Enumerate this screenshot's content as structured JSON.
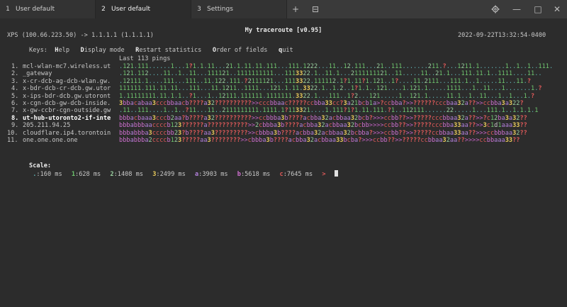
{
  "tabs": [
    {
      "num": "1",
      "label": "User default",
      "active": false
    },
    {
      "num": "2",
      "label": "User default",
      "active": true
    },
    {
      "num": "3",
      "label": "Settings",
      "active": false
    }
  ],
  "toolbar": {
    "new_tab": "+",
    "split": "⊟"
  },
  "window_controls": {
    "settings_icon": "gear-icon",
    "minimize": "—",
    "maximize": "□",
    "close": "✕"
  },
  "header": {
    "title": "My traceroute  [v0.95]",
    "route": "XPS (100.66.223.50) -> 1.1.1.1 (1.1.1.1)",
    "timestamp": "2022-09-22T13:32:54-0400"
  },
  "keys": {
    "label": "Keys:",
    "items": [
      {
        "key": "H",
        "rest": "elp"
      },
      {
        "key": "D",
        "rest": "isplay mode"
      },
      {
        "key": "R",
        "rest": "estart statistics"
      },
      {
        "key": "O",
        "rest": "rder of fields"
      },
      {
        "key": "q",
        "rest": "uit"
      }
    ]
  },
  "pings_header": "Last 113 pings",
  "hops": [
    {
      "num": "1.",
      "host": "mcl-wlan-mc7.wireless.ut",
      "pings": ".121.111......1...1?1.1.11...21.1.11.11.111...111.1222...11..12.111...21..111.......211.?...1211.1.......1..1..1..111."
    },
    {
      "num": "2.",
      "host": "_gateway",
      "pings": ".121.112....11..1..11...111121..1111111111...1113322.1..11.1...2111111121..11.....11..21.1...111.11.1..1111....11.."
    },
    {
      "num": "3.",
      "host": "x-cr-dcb-ag-dcb-wlan.gw.",
      "pings": ".12111.1....111...111..11.122.111.?2111121...1113322.111112.1?1.11?1.121..1?....11.2111...111.1..1.....11...11.?"
    },
    {
      "num": "4.",
      "host": "x-bdr-dcb-cr-dcb.gw.utor",
      "pings": "111111.111.11.11...111...11.1211..1111...121.1.11.3322.1..1.2..1?1.1..121....1.121.1.....1111...1..11...1.......1.?"
    },
    {
      "num": "5.",
      "host": "x-ips-bdr-dcb.gw.utoront",
      "pings": "1.11111111.11.1.1..?1...1..12111.111111.1111111.3322.1...111..1?2...121.....1..121.1.....11.1..1..11...1..1...1.?"
    },
    {
      "num": "6.",
      "host": "x-cgn-dcb-gw-dcb-inside.",
      "pings": "3bbacabaa3cccbbaacb????a32??????????>>cccbbaac?????ccbba33cc?3a21bcb1a>?ccbba?>>??????cccbaa32a??>>ccbba3a322?"
    },
    {
      "num": "7.",
      "host": "x-gw-ccbr-cgn-outside.gw",
      "pings": ".11..111....1..1..?11...11..2111111111.1111.1?113321....1.111?1?1.11.111.?1..112111......22.....1...111.1..1.1.1.1"
    },
    {
      "num": "8.",
      "host": "ut-hub-utoronto2-if-inte",
      "pings": "bbbacbaaa3cccb2aa?b????a32??????????>>ccbbba3b????acbba32acbbaa32bcb?>>>ccbb??>>?????cccbbaa32a??>>?c12ba3a32??",
      "highlight": true
    },
    {
      "num": "9.",
      "host": "205.211.94.25",
      "pings": "bbbabbbaaccccb123??????a???????????>>2cbbba3b????acbba32acbbaa32bcbb>>>>ccbb??>>?????cccbba33aa??>>3c1d1aaa33??"
    },
    {
      "num": "10.",
      "host": "cloudflare.ip4.torontoin",
      "pings": "bbbabbba3ccccbb23?b????aa3?????????>>cbbba3b????acbba32acbbaa32bcbba?>>>ccbb??>>?????ccbbaa33aa??>>>ccbbbaa32??"
    },
    {
      "num": "11.",
      "host": "one.one.one.one",
      "pings": "bbbabbba2ccccb123?????aa3????????>>cbbba3b????acbba32acbbaa33bcba?>>>ccbb??>>?????ccbbaa32aa??>>>>ccbbaaa33??"
    }
  ],
  "scale": {
    "label": "Scale:",
    "items": [
      {
        "sym": ".",
        "text": ":160 ms",
        "color": "#5fb3b3"
      },
      {
        "sym": "1",
        "text": ":628 ms",
        "color": "#6ec46e"
      },
      {
        "sym": "2",
        "text": ":1408 ms",
        "color": "#9ad0a0"
      },
      {
        "sym": "3",
        "text": ":2499 ms",
        "color": "#e6c85a"
      },
      {
        "sym": "a",
        "text": ":3903 ms",
        "color": "#b07fd8"
      },
      {
        "sym": "b",
        "text": ":5618 ms",
        "color": "#d070d0"
      },
      {
        "sym": "c",
        "text": ":7645 ms",
        "color": "#e05a5a"
      },
      {
        "sym": ">",
        "text": "",
        "color": "#e05a5a"
      }
    ]
  },
  "colors": {
    "dot": "#5fb3b3",
    "one": "#6ec46e",
    "two": "#9ad0a0",
    "three": "#e6c85a",
    "a": "#b07fd8",
    "b": "#d070d0",
    "c": "#e05a5a",
    "q": "#e05a5a",
    "gt": "#c060c0"
  }
}
